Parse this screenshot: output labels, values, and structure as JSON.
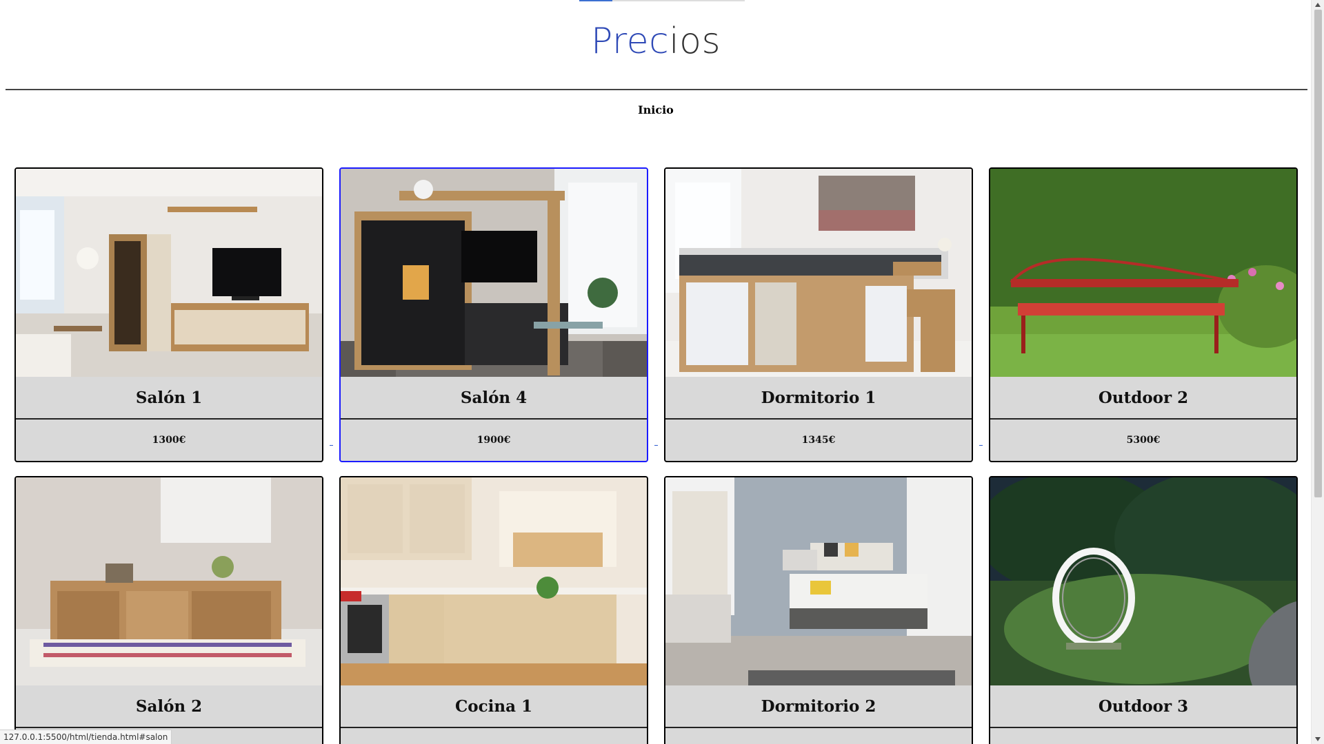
{
  "header": {
    "title_part1": "Prec",
    "title_part2": "ios",
    "nav_link": "Inicio"
  },
  "products": [
    {
      "name": "Salón 1",
      "price": "1300€",
      "scene": "living-room-wall-unit"
    },
    {
      "name": "Salón 4",
      "price": "1900€",
      "scene": "living-room-dark-wall-unit",
      "selected": true
    },
    {
      "name": "Dormitorio 1",
      "price": "1345€",
      "scene": "loft-bed-with-storage"
    },
    {
      "name": "Outdoor 2",
      "price": "5300€",
      "scene": "red-garden-bench"
    },
    {
      "name": "Salón 2",
      "price": "",
      "scene": "wooden-tv-console"
    },
    {
      "name": "Cocina 1",
      "price": "",
      "scene": "l-shaped-kitchen"
    },
    {
      "name": "Dormitorio 2",
      "price": "",
      "scene": "grey-bedroom"
    },
    {
      "name": "Outdoor 3",
      "price": "",
      "scene": "garden-ring-lamp"
    }
  ],
  "status_bar": {
    "url": "127.0.0.1:5500/html/tienda.html#salon"
  },
  "colors": {
    "title_accent": "#2e49b6",
    "selected_border": "#1a1aff",
    "card_bg": "#d9d9d9"
  }
}
